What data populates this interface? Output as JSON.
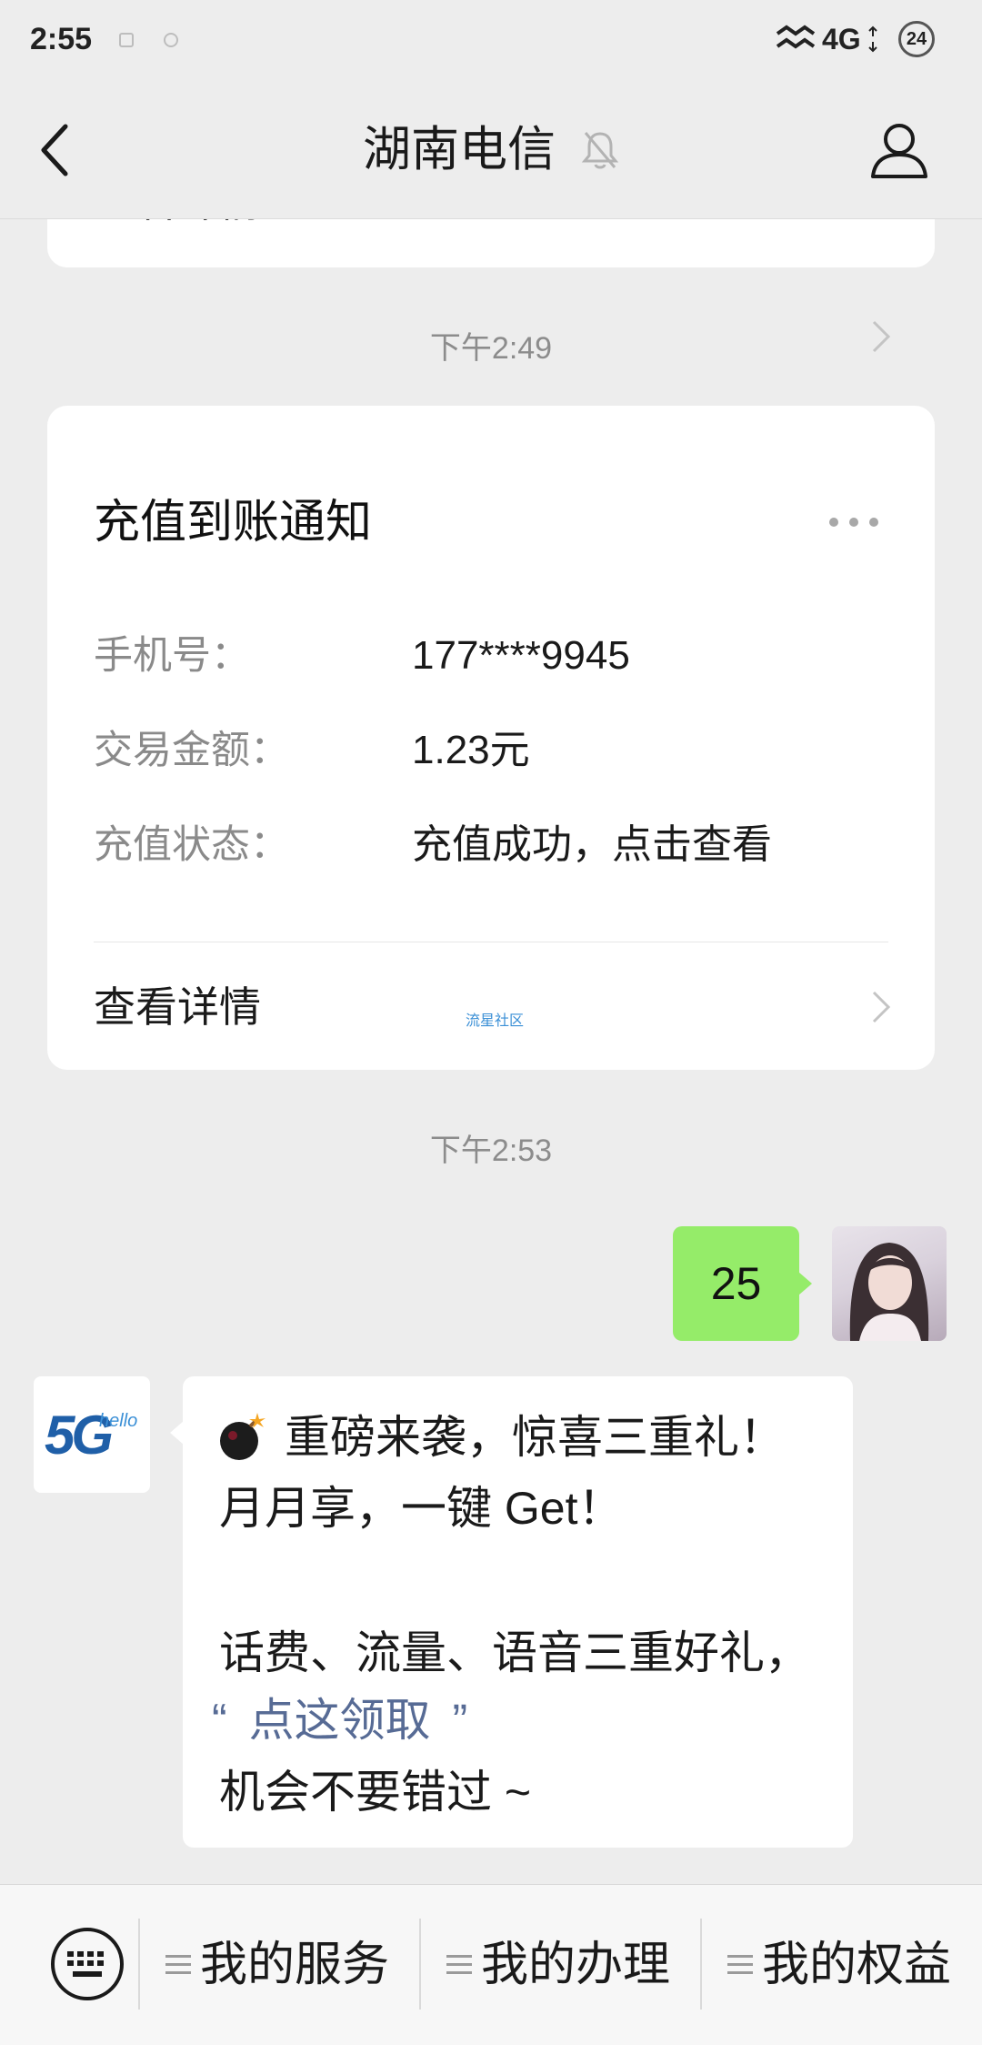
{
  "status_bar": {
    "time": "2:55",
    "network": "4G",
    "battery": "24"
  },
  "header": {
    "title": "湖南电信",
    "muted": true,
    "back_icon": "chevron-left-icon",
    "profile_icon": "person-icon"
  },
  "partial_card": {
    "link_label": "查看详情"
  },
  "timestamps": [
    "下午2:49",
    "下午2:53"
  ],
  "recharge_card": {
    "title": "充值到账通知",
    "rows": [
      {
        "label": "手机号：",
        "value": "177****9945"
      },
      {
        "label": "交易金额：",
        "value": "1.23元"
      },
      {
        "label": "充值状态：",
        "value": "充值成功，点击查看"
      }
    ],
    "link_label": "查看详情",
    "watermark": "流星社区"
  },
  "outgoing_message": {
    "text": "25"
  },
  "official_account": {
    "logo_text": "5G",
    "logo_subtext": "hello"
  },
  "incoming_message": {
    "line1": "重磅来袭，惊喜三重礼！",
    "line2": "月月享，一键 Get！",
    "line3": "话费、流量、语音三重好礼，",
    "quote_open": "“",
    "link_text": "点这领取",
    "quote_close": "”",
    "line5": "机会不要错过 ~"
  },
  "bottom_menu": {
    "keyboard_icon": "keyboard-icon",
    "items": [
      {
        "label": "我的服务",
        "icon": "menu-lines-icon"
      },
      {
        "label": "我的办理",
        "icon": "menu-lines-icon"
      },
      {
        "label": "我的权益",
        "icon": "menu-lines-icon"
      }
    ]
  },
  "colors": {
    "background": "#ededed",
    "outgoing_bubble": "#95ec69",
    "link": "#576b95",
    "watermark": "#3a8fd6"
  }
}
